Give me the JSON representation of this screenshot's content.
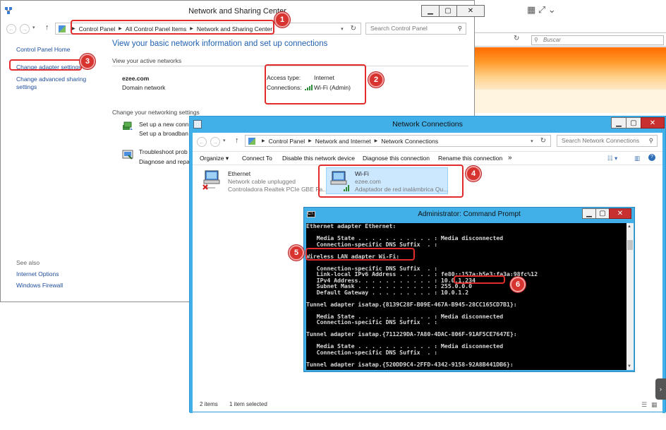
{
  "browser": {
    "search_placeholder": "Buscar"
  },
  "nsc": {
    "title": "Network and Sharing Center",
    "breadcrumb": [
      "Control Panel",
      "All Control Panel Items",
      "Network and Sharing Center"
    ],
    "search_placeholder": "Search Control Panel",
    "sidebar": {
      "home": "Control Panel Home",
      "change_adapter": "Change adapter settings",
      "advanced_sharing": "Change advanced sharing settings",
      "see_also": "See also",
      "internet_options": "Internet Options",
      "windows_firewall": "Windows Firewall"
    },
    "heading": "View your basic network information and set up connections",
    "active_networks_label": "View your active networks",
    "network_name": "ezee.com",
    "network_type": "Domain network",
    "access_type_label": "Access type:",
    "access_type_value": "Internet",
    "connections_label": "Connections:",
    "connections_value": "Wi-Fi (Admin)",
    "change_settings_label": "Change your networking settings",
    "setup_link": "Set up a new conn",
    "setup_desc": "Set up a broadban",
    "troubleshoot_link": "Troubleshoot prob",
    "troubleshoot_desc": "Diagnose and repa"
  },
  "nc": {
    "title": "Network Connections",
    "breadcrumb": [
      "Control Panel",
      "Network and Internet",
      "Network Connections"
    ],
    "search_placeholder": "Search Network Connections",
    "toolbar": [
      "Organize",
      "Connect To",
      "Disable this network device",
      "Diagnose this connection",
      "Rename this connection",
      "»"
    ],
    "adapters": [
      {
        "name": "Ethernet",
        "status": "Network cable unplugged",
        "device": "Controladora Realtek PCIe GBE Fa..."
      },
      {
        "name": "Wi-Fi",
        "status": "ezee.com",
        "device": "Adaptador de red inalámbrica Qu..."
      }
    ],
    "status_items": "2 items",
    "status_selected": "1 item selected"
  },
  "cmd": {
    "title": "Administrator: Command Prompt",
    "lines": [
      "Ethernet adapter Ethernet:",
      "",
      "   Media State . . . . . . . . . . . : Media disconnected",
      "   Connection-specific DNS Suffix  . :",
      "",
      "Wireless LAN adapter Wi-Fi:",
      "",
      "   Connection-specific DNS Suffix  . :",
      "   Link-local IPv6 Address . . . . . : fe80::157a:b5e3:fa3a:98fc%12",
      "   IPv4 Address. . . . . . . . . . . : 10.0.1.234",
      "   Subnet Mask . . . . . . . . . . . : 255.0.0.0",
      "   Default Gateway . . . . . . . . . : 10.0.1.2",
      "",
      "Tunnel adapter isatap.{8139C28F-B09E-467A-B945-28CC165CD7B1}:",
      "",
      "   Media State . . . . . . . . . . . : Media disconnected",
      "   Connection-specific DNS Suffix  . :",
      "",
      "Tunnel adapter isatap.{711229DA-7A80-4DAC-806F-91AF5CE7647E}:",
      "",
      "   Media State . . . . . . . . . . . : Media disconnected",
      "   Connection-specific DNS Suffix  . :",
      "",
      "Tunnel adapter isatap.{520DD9C4-2FFD-4342-9158-92A8B441DB6}:"
    ]
  },
  "annotations": [
    "1",
    "2",
    "3",
    "4",
    "5",
    "6"
  ],
  "colors": {
    "annotation_red": "#e02c2c",
    "title_blue": "#42b0e8",
    "link_blue": "#1f5fb0"
  }
}
